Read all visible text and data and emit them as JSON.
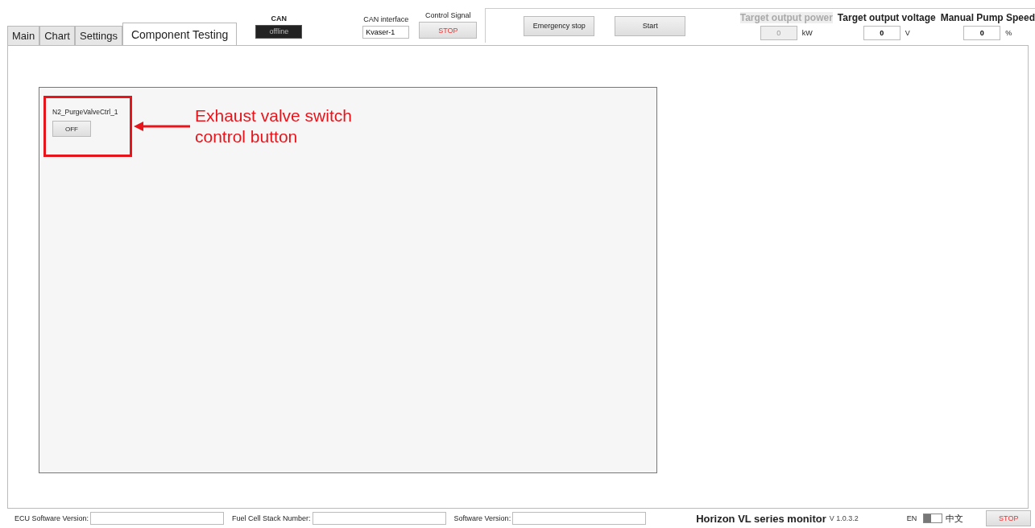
{
  "tabs": [
    {
      "label": "Main",
      "selected": false
    },
    {
      "label": "Chart",
      "selected": false
    },
    {
      "label": "Settings",
      "selected": false
    },
    {
      "label": "Component Testing",
      "selected": true
    }
  ],
  "can": {
    "label": "CAN",
    "status": "offline",
    "on": false
  },
  "can_interface": {
    "label": "CAN interface",
    "value": "Kvaser-1"
  },
  "control_signal": {
    "label": "Control Signal",
    "button": "STOP"
  },
  "buttons": [
    "Emergency stop",
    "Start"
  ],
  "targets": [
    {
      "label": "Target output power",
      "value": "0",
      "unit": "kW",
      "disabled": true
    },
    {
      "label": "Target output voltage",
      "value": "0",
      "unit": "V",
      "disabled": false
    },
    {
      "label": "Manual Pump Speed",
      "value": "0",
      "unit": "%",
      "disabled": false
    }
  ],
  "component": {
    "label": "N2_PurgeValveCtrl_1",
    "button": "OFF",
    "on": false
  },
  "annotation": {
    "text": "Exhaust valve switch control button",
    "color": "#e8141b"
  },
  "status_bar": {
    "fields": [
      {
        "label": "ECU Software Version:"
      },
      {
        "label": "Fuel Cell Stack Number:"
      },
      {
        "label": "Software Version:"
      }
    ],
    "app_title": "Horizon VL series monitor",
    "version": "V 1.0.3.2",
    "language": {
      "left": "EN",
      "right": "中文",
      "on": false
    },
    "stop_button": "STOP"
  }
}
